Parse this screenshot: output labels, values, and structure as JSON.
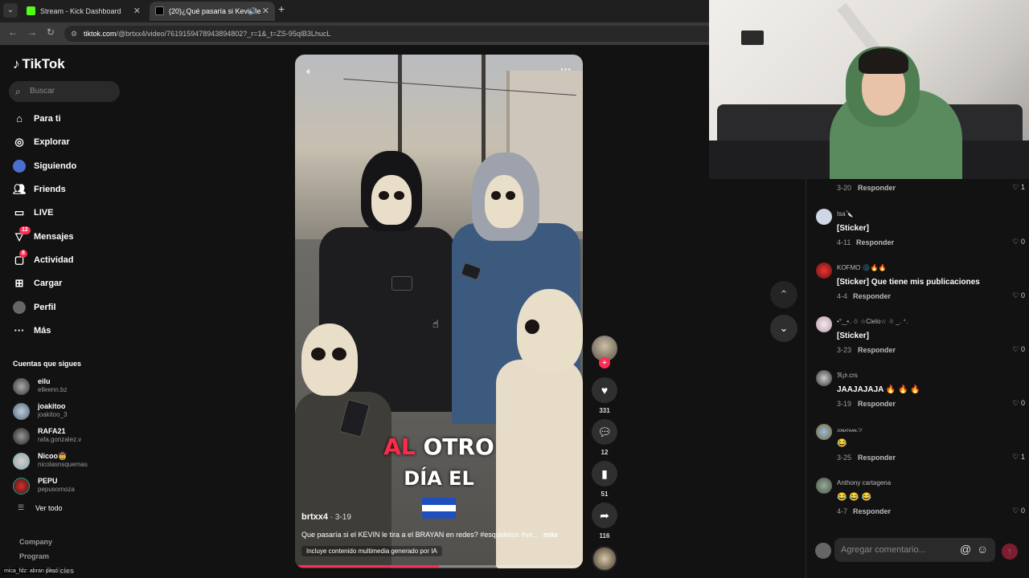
{
  "browser": {
    "tabs": [
      {
        "title": "Stream - Kick Dashboard"
      },
      {
        "title": "(20)¿Qué pasaría si Kevin le"
      }
    ],
    "url_domain": "tiktok.com",
    "url_path": "/@brtxx4/video/7619159478943894802?_r=1&_t=ZS-95qlB3LhucL"
  },
  "sidebar": {
    "logo": "TikTok",
    "search_placeholder": "Buscar",
    "menu": [
      {
        "label": "Para ti",
        "icon": "home-icon"
      },
      {
        "label": "Explorar",
        "icon": "compass-icon"
      },
      {
        "label": "Siguiendo",
        "icon": "following-avatar-icon"
      },
      {
        "label": "Friends",
        "icon": "friends-icon"
      },
      {
        "label": "LIVE",
        "icon": "live-icon"
      },
      {
        "label": "Mensajes",
        "icon": "messages-icon",
        "badge": "12"
      },
      {
        "label": "Actividad",
        "icon": "activity-icon",
        "badge": "8"
      },
      {
        "label": "Cargar",
        "icon": "upload-icon"
      },
      {
        "label": "Perfil",
        "icon": "profile-icon"
      },
      {
        "label": "Más",
        "icon": "more-icon"
      }
    ],
    "following_title": "Cuentas que sigues",
    "following": [
      {
        "name": "eilu",
        "handle": "elleenn.bz"
      },
      {
        "name": "joakitoo",
        "handle": "joakitoo_3"
      },
      {
        "name": "RAFA21",
        "handle": "rafa.gonzalez.v"
      },
      {
        "name": "Nicoo🤠",
        "handle": "nicolasnsquemas"
      },
      {
        "name": "PEPU",
        "handle": "pepusomoza"
      }
    ],
    "see_all": "Ver todo",
    "footer": [
      "Company",
      "Program",
      "Policies"
    ],
    "overlay_user": "mica_fdz: abran paso"
  },
  "video": {
    "overlay_line1_red": "AL",
    "overlay_line1_rest": " OTRO",
    "overlay_line2": "DÍA EL",
    "author": "brtxx4",
    "date": " · 3-19",
    "caption": "Que pasaría si el KEVIN le tira a el BRAYAN en redes? #esqueletos #vir...",
    "caption_more": "más",
    "ai_label": "Incluye contenido multimedia generado por IA",
    "progress": 0.5
  },
  "actions": {
    "likes": "331",
    "comments": "12",
    "saves": "51",
    "shares": "116"
  },
  "comments": {
    "first": {
      "date": "3-20",
      "reply": "Responder",
      "likes": "1"
    },
    "items": [
      {
        "user": "Isa🔪",
        "text": "[Sticker]",
        "date": "4-11",
        "reply": "Responder",
        "likes": "0"
      },
      {
        "user": "KOFMO 🌑🔥🔥",
        "text": "[Sticker] Que tiene mis publicaciones",
        "date": "4-4",
        "reply": "Responder",
        "likes": "0"
      },
      {
        "user": "•°‿•. ☃ ☆Cielo☆ ☃ _. ⁺.",
        "text": "[Sticker]",
        "date": "3-23",
        "reply": "Responder",
        "likes": "0"
      },
      {
        "user": "ℜ𝔷𝔡.crs",
        "text": "JAAJAJAJA 🔥 🔥 🔥",
        "date": "3-19",
        "reply": "Responder",
        "likes": "0"
      },
      {
        "user": "ᴊᴏɴᴀᴛʜᴀɴ.ツ",
        "text": "😂",
        "date": "3-25",
        "reply": "Responder",
        "likes": "1"
      },
      {
        "user": "Anthony cartagena",
        "text": "😂 😂 😂",
        "date": "4-7",
        "reply": "Responder",
        "likes": "0"
      }
    ],
    "input_placeholder": "Agregar comentario..."
  }
}
